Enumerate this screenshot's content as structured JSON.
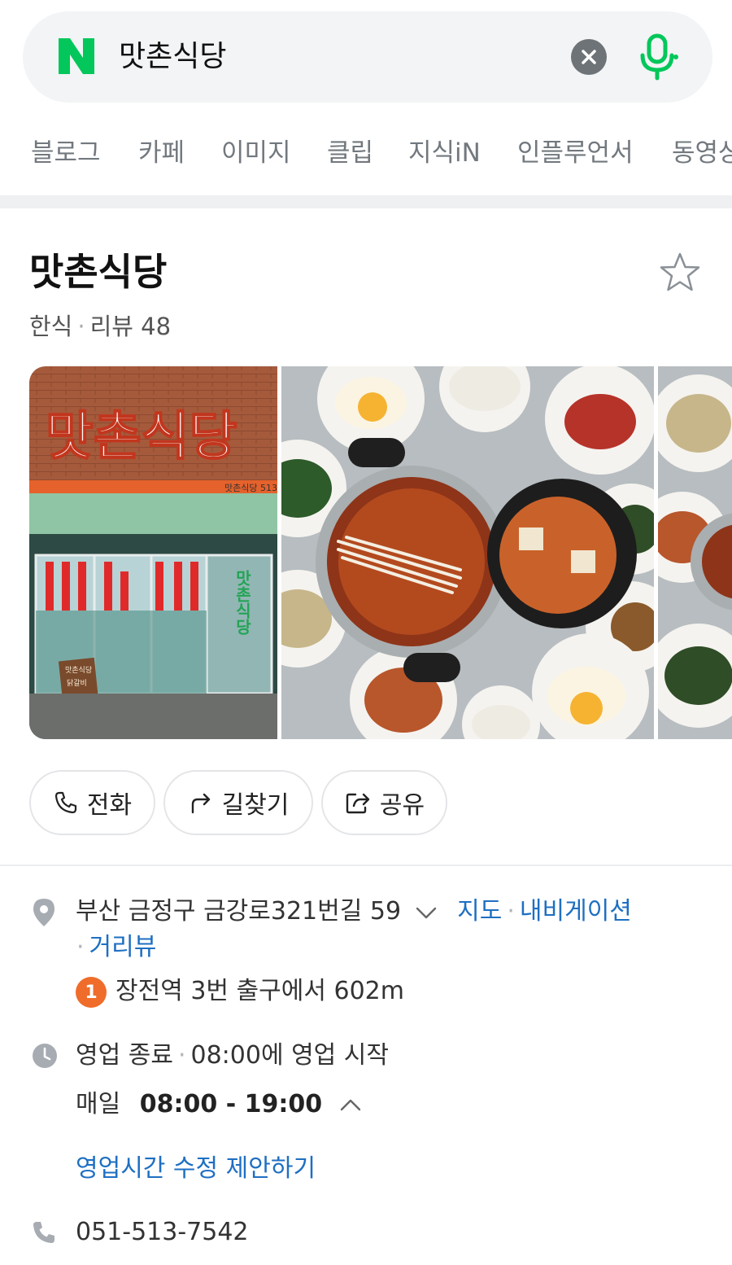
{
  "search": {
    "logo": "N",
    "query": "맛촌식당"
  },
  "tabs": [
    "블로그",
    "카페",
    "이미지",
    "클립",
    "지식iN",
    "인플루언서",
    "동영상"
  ],
  "place": {
    "name": "맛촌식당",
    "category": "한식",
    "review_label": "리뷰 48",
    "photo_sign_text": "맛촌식당",
    "photo_sign_sub": "맛촌식당 513",
    "photo_window_sign": "맛촌식당",
    "photo_board_title": "맛촌식당",
    "photo_board_sub": "닭갈비"
  },
  "actions": {
    "call": "전화",
    "directions": "길찾기",
    "share": "공유"
  },
  "address": {
    "text": "부산 금정구 금강로321번길 59",
    "map_link": "지도",
    "navigation_link": "내비게이션",
    "street_view_link": "거리뷰",
    "subway_line": "1",
    "subway_text": "장전역 3번 출구에서 602m"
  },
  "hours": {
    "status": "영업 종료",
    "next_open": "08:00에 영업 시작",
    "day_label": "매일",
    "hours_range": "08:00 - 19:00",
    "edit_link": "영업시간 수정 제안하기"
  },
  "phone": "051-513-7542",
  "colors": {
    "naver_green": "#03c75a",
    "link_blue": "#1e6fc2",
    "subway_line1": "#ef6c2a"
  }
}
